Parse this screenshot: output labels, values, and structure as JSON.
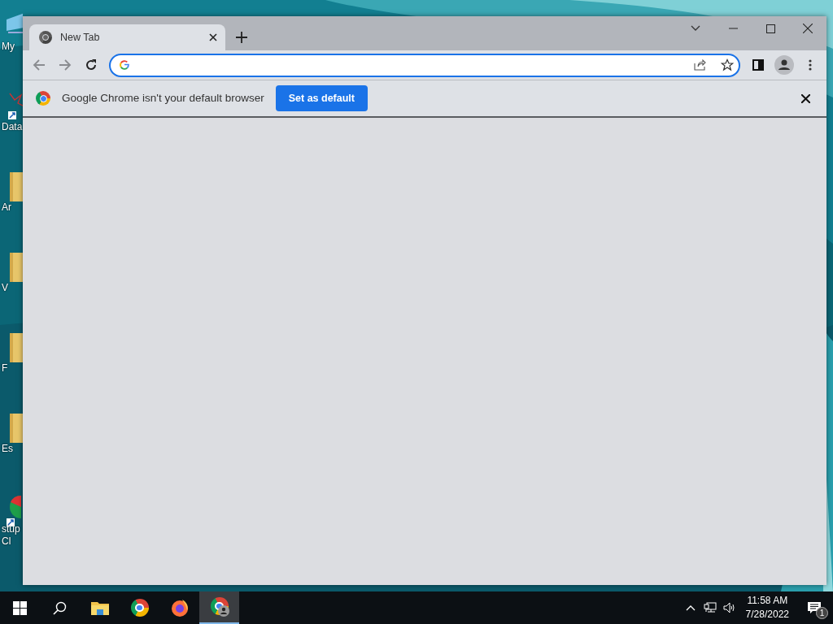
{
  "desktop_icons": [
    {
      "kind": "computer",
      "lines": [
        "My"
      ]
    },
    {
      "kind": "shortcut",
      "lines": [
        "Data"
      ]
    },
    {
      "kind": "folder",
      "lines": [
        "Ar"
      ]
    },
    {
      "kind": "folder",
      "lines": [
        "V"
      ]
    },
    {
      "kind": "folder",
      "lines": [
        "F"
      ]
    },
    {
      "kind": "folder",
      "lines": [
        "Es"
      ]
    },
    {
      "kind": "app",
      "lines": [
        "stup",
        "Cl"
      ]
    }
  ],
  "browser": {
    "tab": {
      "title": "New Tab"
    },
    "infobar": {
      "message": "Google Chrome isn't your default browser",
      "button": "Set as default"
    }
  },
  "taskbar": {
    "apps": [
      {
        "kind": "start",
        "active": false
      },
      {
        "kind": "search",
        "active": false
      },
      {
        "kind": "explorer",
        "active": false
      },
      {
        "kind": "chrome",
        "active": false
      },
      {
        "kind": "firefox",
        "active": false
      },
      {
        "kind": "chrome-profile",
        "active": true
      }
    ],
    "time": "11:58 AM",
    "date": "7/28/2022",
    "notifications": "1"
  }
}
